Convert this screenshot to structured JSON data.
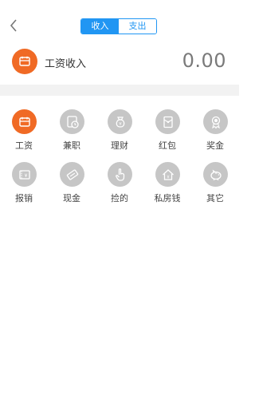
{
  "header": {
    "tabs": [
      {
        "label": "收入",
        "active": true
      },
      {
        "label": "支出",
        "active": false
      }
    ],
    "accent": "#2196f3"
  },
  "summary": {
    "icon": "calendar-wallet-icon",
    "label": "工资收入",
    "amount": "0.00",
    "icon_color": "#f06a25"
  },
  "categories": [
    {
      "label": "工资",
      "icon": "calendar-wallet-icon",
      "selected": true
    },
    {
      "label": "兼职",
      "icon": "clock-icon",
      "selected": false
    },
    {
      "label": "理财",
      "icon": "money-bag-icon",
      "selected": false
    },
    {
      "label": "红包",
      "icon": "red-envelope-icon",
      "selected": false
    },
    {
      "label": "奖金",
      "icon": "award-medal-icon",
      "selected": false
    },
    {
      "label": "报销",
      "icon": "receipt-icon",
      "selected": false
    },
    {
      "label": "现金",
      "icon": "cash-note-icon",
      "selected": false
    },
    {
      "label": "捡的",
      "icon": "hand-pointer-icon",
      "selected": false
    },
    {
      "label": "私房钱",
      "icon": "house-money-icon",
      "selected": false
    },
    {
      "label": "其它",
      "icon": "piggy-bank-icon",
      "selected": false
    }
  ]
}
